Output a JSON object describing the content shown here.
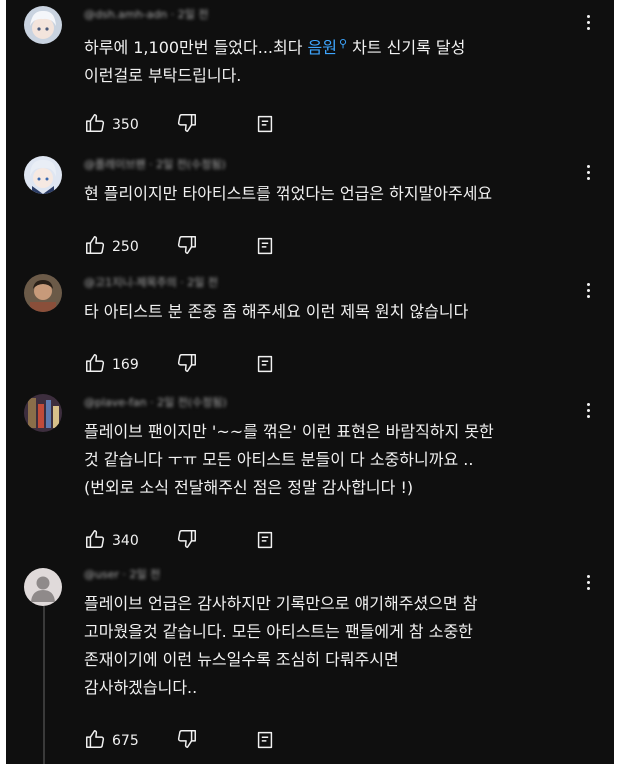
{
  "comments": [
    {
      "meta": "@dsh.amh-adn · 2일 전",
      "lines": [
        {
          "before": "하루에 1,100만번 들었다...최다 ",
          "tag": "음원",
          "after": " 차트 신기록 달성"
        },
        {
          "before": "이런걸로 부탁드립니다.",
          "tag": "",
          "after": ""
        }
      ],
      "likes": "350",
      "avatar": "anime-white-hair"
    },
    {
      "meta": "@플레이브팬 · 2일 전(수정됨)",
      "lines": [
        {
          "before": "현 플리이지만 타아티스트를 꺾었다는 언급은 하지말아주세요",
          "tag": "",
          "after": ""
        }
      ],
      "likes": "250",
      "avatar": "anime-blue-hair"
    },
    {
      "meta": "@고1지니-제목주의 · 2일 전",
      "lines": [
        {
          "before": "타 아티스트 분 존중 좀 해주세요 이런 제목 원치 않습니다",
          "tag": "",
          "after": ""
        }
      ],
      "likes": "169",
      "avatar": "photo-person"
    },
    {
      "meta": "@plave-fan · 2일 전(수정됨)",
      "lines": [
        {
          "before": "플레이브 팬이지만 '~~를 꺾은' 이런 표현은 바람직하지 못한",
          "tag": "",
          "after": ""
        },
        {
          "before": "것 같습니다 ㅜㅠ 모든 아티스트 분들이 다 소중하니까요 ..",
          "tag": "",
          "after": ""
        },
        {
          "before": "(번외로 소식 전달해주신 점은 정말 감사합니다 !)",
          "tag": "",
          "after": ""
        }
      ],
      "likes": "340",
      "avatar": "photo-stage"
    },
    {
      "meta": "@user · 2일 전",
      "lines": [
        {
          "before": "플레이브 언급은 감사하지만 기록만으로 얘기해주셨으면 참",
          "tag": "",
          "after": ""
        },
        {
          "before": "고마웠을것 같습니다. 모든 아티스트는 팬들에게 참 소중한",
          "tag": "",
          "after": ""
        },
        {
          "before": "존재이기에 이런 뉴스일수록 조심히 다뤄주시면",
          "tag": "",
          "after": ""
        },
        {
          "before": "감사하겠습니다..",
          "tag": "",
          "after": ""
        }
      ],
      "likes": "675",
      "avatar": "default-silhouette"
    }
  ],
  "icons": {
    "like": "thumb-up-icon",
    "dislike": "thumb-down-icon",
    "reply": "reply-comment-icon",
    "more": "more-vertical-icon",
    "search_tag": "search-icon"
  },
  "colors": {
    "background": "#0f0f0f",
    "text": "#f1f1f1",
    "meta": "#aaaaaa",
    "link": "#3ea6ff"
  }
}
